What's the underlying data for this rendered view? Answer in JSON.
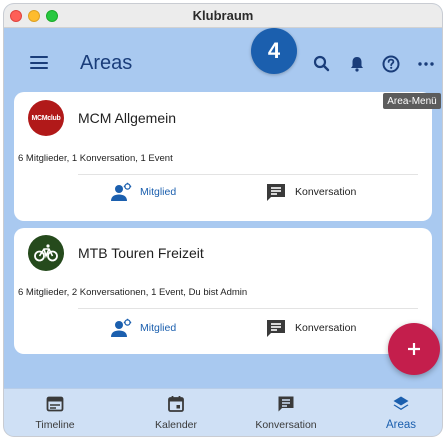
{
  "window": {
    "title": "Klubraum"
  },
  "appbar": {
    "title": "Areas"
  },
  "step_badge": "4",
  "tooltip": "Area-Menü",
  "cards": [
    {
      "title": "MCM Allgemein",
      "avatar_text": "MCMclub",
      "meta": "6 Mitglieder, 1 Konversation, 1 Event",
      "mitglied_label": "Mitglied",
      "konversation_label": "Konversation"
    },
    {
      "title": "MTB Touren Freizeit",
      "meta": "6 Mitglieder, 2 Konversationen, 1 Event, Du bist Admin",
      "mitglied_label": "Mitglied",
      "konversation_label": "Konversation"
    }
  ],
  "bottom_nav": {
    "items": [
      {
        "label": "Timeline",
        "icon": "timeline-icon"
      },
      {
        "label": "Kalender",
        "icon": "calendar-icon"
      },
      {
        "label": "Konversation",
        "icon": "conversation-icon"
      },
      {
        "label": "Areas",
        "icon": "areas-icon",
        "active": true
      }
    ]
  },
  "colors": {
    "accent": "#1b5fae",
    "appbar_bg": "#a9c9f0",
    "fab": "#c41e4c",
    "nav_bg": "#cfe0f5"
  }
}
